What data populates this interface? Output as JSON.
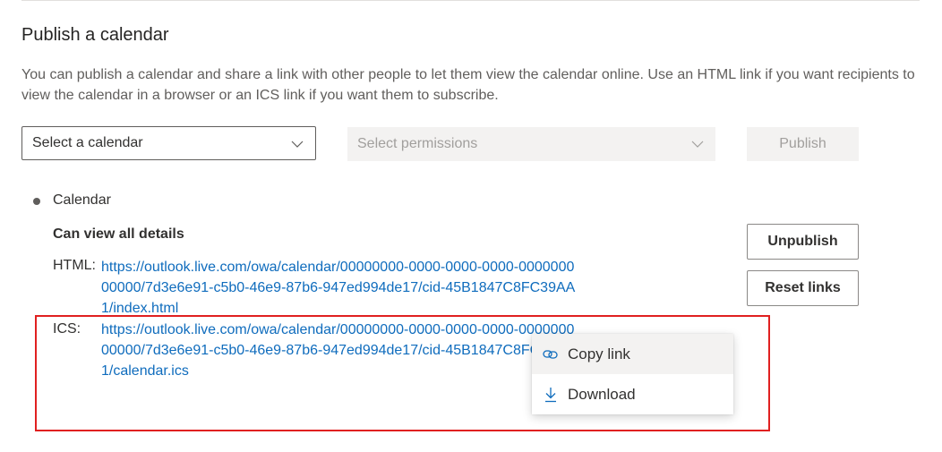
{
  "section": {
    "title": "Publish a calendar",
    "description": "You can publish a calendar and share a link with other people to let them view the calendar online. Use an HTML link if you want recipients to view the calendar in a browser or an ICS link if you want them to subscribe."
  },
  "controls": {
    "calendar_select": "Select a calendar",
    "permissions_select": "Select permissions",
    "publish_label": "Publish"
  },
  "published": {
    "calendar_name": "Calendar",
    "permission": "Can view all details",
    "html_label": "HTML:",
    "html_link": "https://outlook.live.com/owa/calendar/00000000-0000-0000-0000-000000000000/7d3e6e91-c5b0-46e9-87b6-947ed994de17/cid-45B1847C8FC39AA1/index.html",
    "ics_label": "ICS:",
    "ics_link": "https://outlook.live.com/owa/calendar/00000000-0000-0000-0000-000000000000/7d3e6e91-c5b0-46e9-87b6-947ed994de17/cid-45B1847C8FC39AA1/calendar.ics",
    "unpublish_label": "Unpublish",
    "reset_label": "Reset links"
  },
  "context_menu": {
    "items": [
      {
        "label": "Copy link",
        "icon": "link-icon"
      },
      {
        "label": "Download",
        "icon": "download-icon"
      }
    ]
  },
  "colors": {
    "link": "#0f6cbd",
    "highlight": "#e02020",
    "disabled_bg": "#f3f2f1"
  }
}
